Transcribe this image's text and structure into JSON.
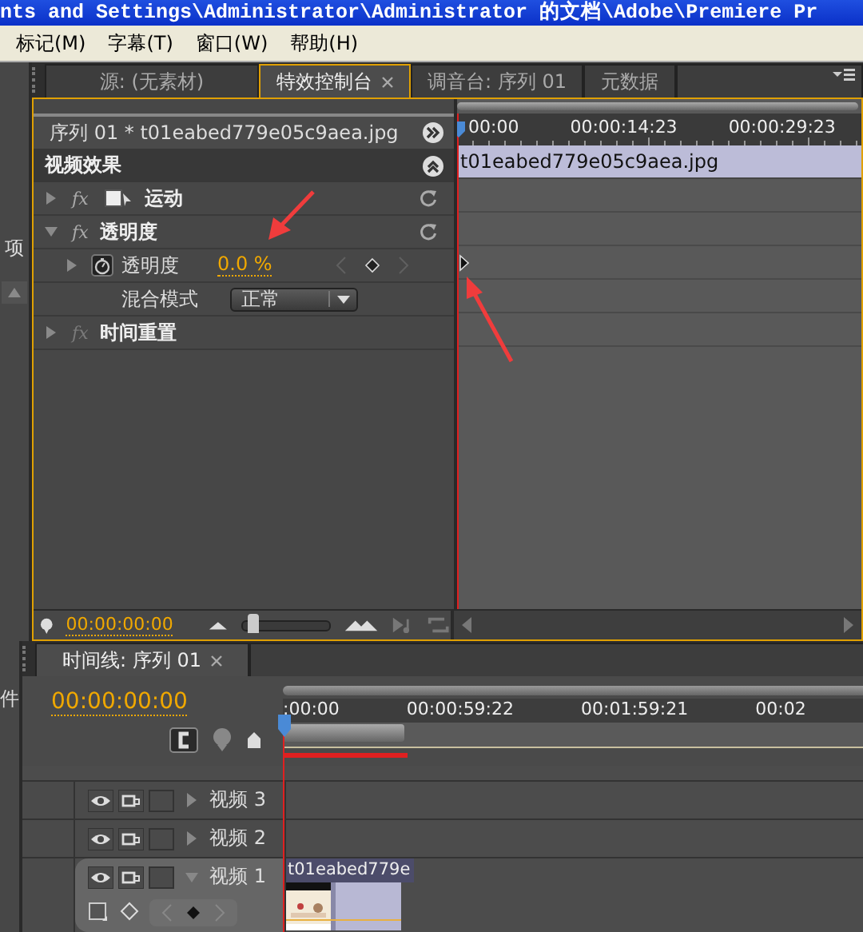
{
  "window": {
    "title": "nts and Settings\\Administrator\\Administrator 的文档\\Adobe\\Premiere Pr"
  },
  "menu": [
    "标记(M)",
    "字幕(T)",
    "窗口(W)",
    "帮助(H)"
  ],
  "side_panel": {
    "upper_label": "项",
    "lower_label": "件"
  },
  "effect_panel": {
    "tabs": [
      {
        "label": "源: (无素材)",
        "selected": false,
        "closable": false
      },
      {
        "label": "特效控制台",
        "selected": true,
        "closable": true
      },
      {
        "label": "调音台: 序列 01",
        "selected": false,
        "closable": false
      },
      {
        "label": "元数据",
        "selected": false,
        "closable": false
      }
    ],
    "clip_header": "序列 01 * t01eabed779e05c9aea.jpg",
    "section": "视频效果",
    "effects": [
      {
        "name": "运动",
        "icon": "fx",
        "kind": "motion",
        "expanded": false,
        "enabled": true
      },
      {
        "name": "透明度",
        "icon": "fx",
        "kind": "opacity",
        "expanded": true,
        "enabled": true,
        "children": [
          {
            "kind": "param",
            "name": "透明度",
            "value": "0.0 %"
          },
          {
            "kind": "dropdown",
            "name": "混合模式",
            "value": "正常"
          }
        ]
      },
      {
        "name": "时间重置",
        "icon": "fx",
        "kind": "time",
        "expanded": false,
        "enabled": false
      }
    ],
    "ruler": [
      "00:00",
      "00:00:14:23",
      "00:00:29:23"
    ],
    "clip_bar": "t01eabed779e05c9aea.jpg",
    "timecode": "00:00:00:00",
    "zoom": {
      "level": 0.05
    }
  },
  "timeline": {
    "tab": "时间线: 序列 01",
    "timecode": "00:00:00:00",
    "ruler": [
      ":00:00",
      "00:00:59:22",
      "00:01:59:21",
      "00:02"
    ],
    "tracks": [
      {
        "name": "视频 3",
        "expanded": false
      },
      {
        "name": "视频 2",
        "expanded": false
      },
      {
        "name": "视频 1",
        "expanded": true,
        "clip": "t01eabed779e"
      }
    ]
  }
}
